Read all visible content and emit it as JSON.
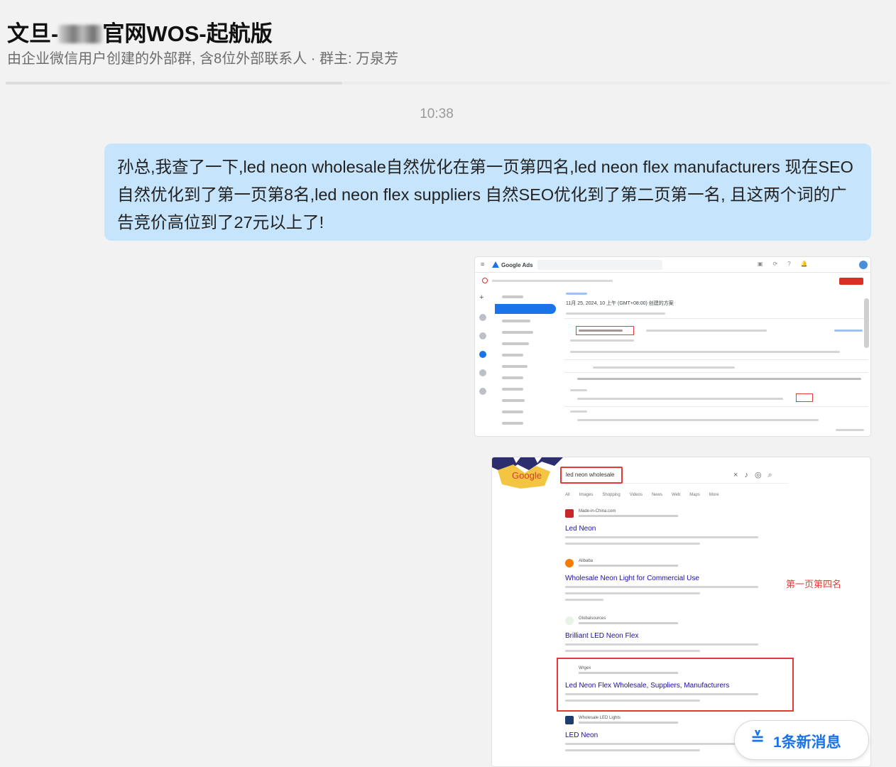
{
  "chat": {
    "title_prefix": "文旦-",
    "title_suffix": "官网WOS-起航版",
    "subtitle": "由企业微信用户创建的外部群, 含8位外部联系人 · 群主: 万泉芳"
  },
  "messages": {
    "timestamp": "10:38",
    "text": "孙总,我查了一下,led neon wholesale自然优化在第一页第四名,led neon flex manufacturers 现在SEO自然优化到了第一页第8名,led neon flex suppliers 自然SEO优化到了第二页第一名, 且这两个词的广告竞价高位到了27元以上了!"
  },
  "screenshot_ads": {
    "app_name": "Google Ads",
    "date_text": "11月 25, 2024, 10 上午 (GMT+08:00) 创建的方案"
  },
  "screenshot_serp": {
    "logo_text": "Google",
    "query": "led neon wholesale",
    "tabs": [
      "All",
      "Images",
      "Shopping",
      "Videos",
      "News",
      "Web",
      "Maps",
      "More"
    ],
    "results": [
      {
        "site": "Made-in-China.com",
        "title": "Led Neon"
      },
      {
        "site": "Alibaba",
        "title": "Wholesale Neon Light for Commercial Use"
      },
      {
        "site": "Globalsources",
        "title": "Brilliant LED Neon Flex"
      },
      {
        "site": "Wrgex",
        "title": "Led Neon Flex Wholesale, Suppliers, Manufacturers"
      },
      {
        "site": "Wholesale LED Lights",
        "title": "LED Neon"
      }
    ],
    "annotation": "第一页第四名"
  },
  "new_message": {
    "label": "1条新消息",
    "icon": "double-chevron-down-icon"
  },
  "colors": {
    "bubble": "#c6e4fb",
    "accent": "#1a73e8",
    "highlight_red": "#e53935"
  }
}
